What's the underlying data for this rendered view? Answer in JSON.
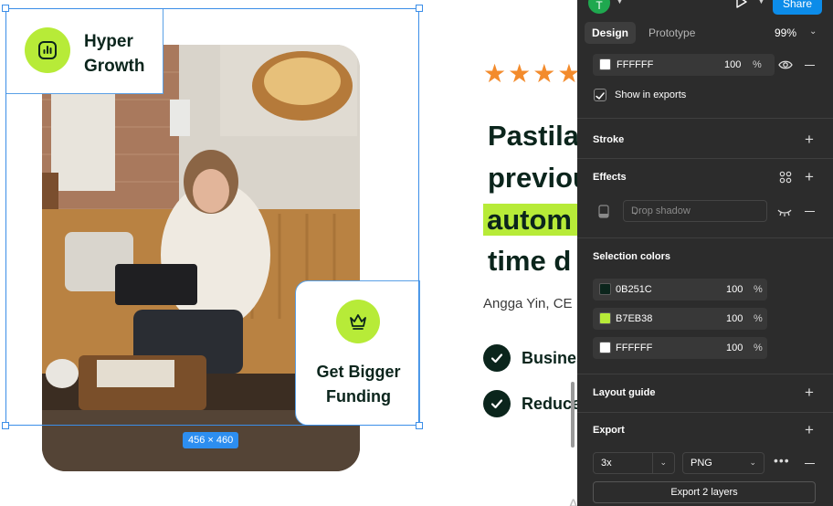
{
  "canvas": {
    "hyper_card": {
      "title": "Hyper\nGrowth",
      "icon": "chart-bars-icon"
    },
    "funding_card": {
      "title": "Get Bigger\nFunding",
      "icon": "crown-icon"
    },
    "selection_size": "456 × 460",
    "rating_stars": [
      "★",
      "★",
      "★",
      "★"
    ],
    "headline_lines": [
      "Pastila",
      "previou",
      "autom",
      "time d"
    ],
    "author": "Angga Yin, CE",
    "benefits": [
      "Busines",
      "Reduce"
    ],
    "watermark": "Activate Windows"
  },
  "panel": {
    "avatar_initial": "T",
    "share_label": "Share",
    "tabs": [
      {
        "label": "Design",
        "active": true
      },
      {
        "label": "Prototype",
        "active": false
      }
    ],
    "zoom": "99%",
    "fill": {
      "hex": "FFFFFF",
      "opacity": "100",
      "pct": "%"
    },
    "show_in_exports": "Show in exports",
    "stroke_title": "Stroke",
    "effects_title": "Effects",
    "effect_type": "Drop shadow",
    "selection_colors_title": "Selection colors",
    "selection_colors": [
      {
        "hex": "0B251C",
        "color": "#0B251C",
        "opacity": "100",
        "pct": "%"
      },
      {
        "hex": "B7EB38",
        "color": "#B7EB38",
        "opacity": "100",
        "pct": "%"
      },
      {
        "hex": "FFFFFF",
        "color": "#FFFFFF",
        "opacity": "100",
        "pct": "%"
      }
    ],
    "layout_guide_title": "Layout guide",
    "export_title": "Export",
    "export_scale": "3x",
    "export_format": "PNG",
    "export_button": "Export 2 layers"
  },
  "colors": {
    "accent": "#B7EB38",
    "dark": "#0B251C",
    "figma_blue": "#0C8CE9",
    "star": "#F38B2C"
  }
}
